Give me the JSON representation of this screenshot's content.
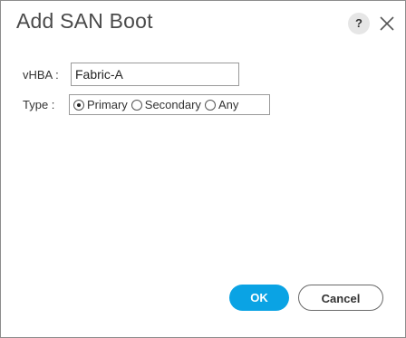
{
  "dialog": {
    "title": "Add SAN Boot",
    "help_icon": "question-mark-icon",
    "close_icon": "close-icon"
  },
  "form": {
    "vhba_label": "vHBA :",
    "vhba_value": "Fabric-A",
    "type_label": "Type  :",
    "type_options": [
      {
        "label": "Primary",
        "checked": true
      },
      {
        "label": "Secondary",
        "checked": false
      },
      {
        "label": "Any",
        "checked": false
      }
    ]
  },
  "buttons": {
    "ok_label": "OK",
    "cancel_label": "Cancel"
  },
  "colors": {
    "accent": "#0aa3e4"
  }
}
